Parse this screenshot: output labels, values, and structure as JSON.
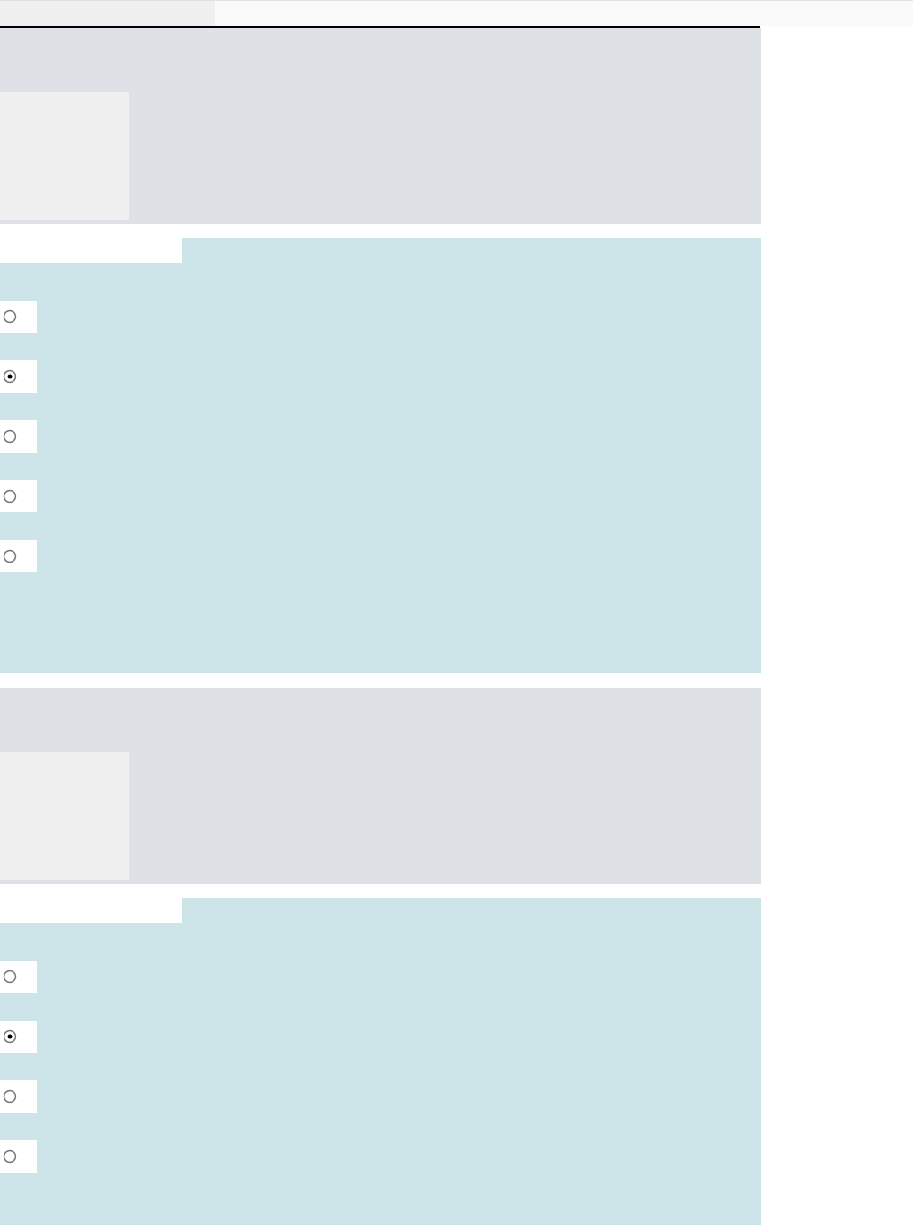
{
  "questions": [
    {
      "options": [
        {
          "selected": false
        },
        {
          "selected": true
        },
        {
          "selected": false
        },
        {
          "selected": false
        },
        {
          "selected": false
        }
      ]
    },
    {
      "options": [
        {
          "selected": false
        },
        {
          "selected": true
        },
        {
          "selected": false
        },
        {
          "selected": false
        }
      ]
    }
  ]
}
